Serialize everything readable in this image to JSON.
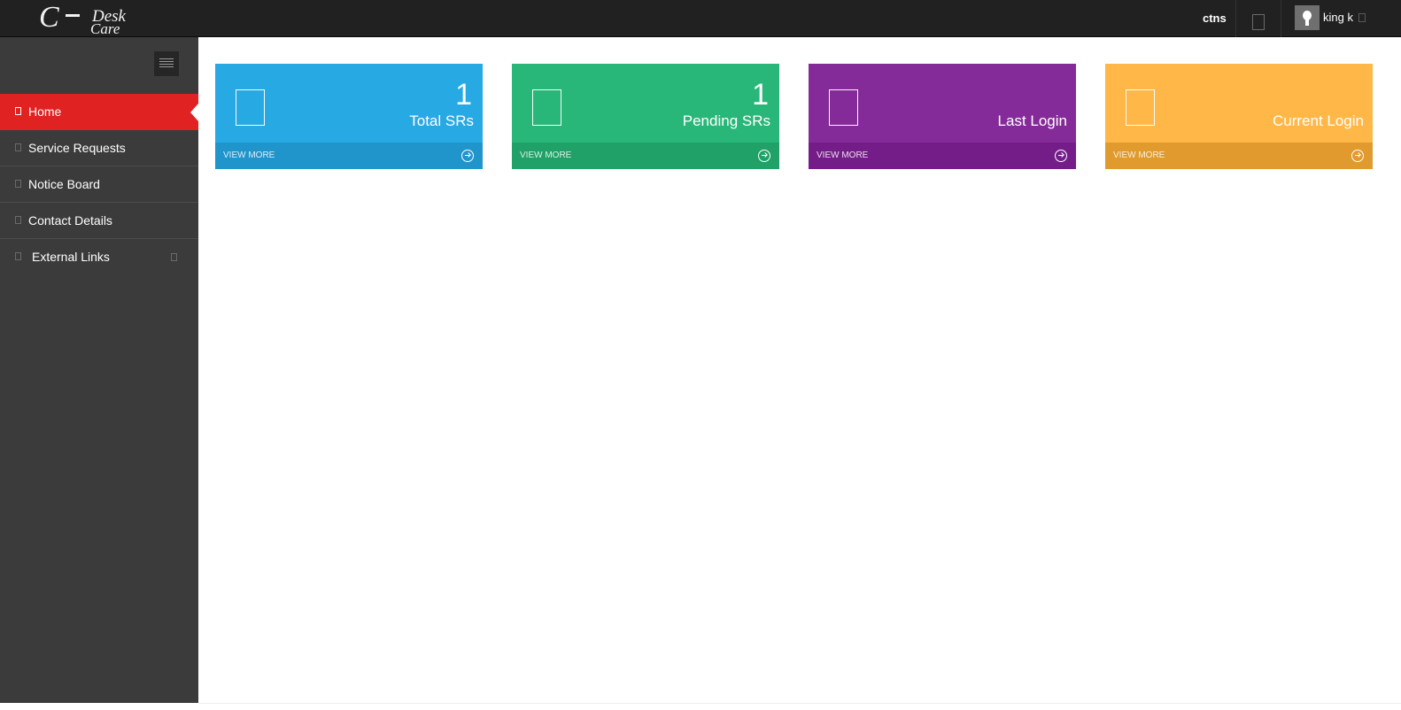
{
  "logo": {
    "letter": "C",
    "word_top": "Desk",
    "word_bottom": "Care"
  },
  "header": {
    "org": "ctns",
    "notification_icon": "notification-icon",
    "user_name": "king k",
    "user_caret_icon": "chevron-down-icon"
  },
  "sidebar": {
    "toggle_icon": "hamburger-icon",
    "items": [
      {
        "label": "Home",
        "icon": "home-icon",
        "active": true
      },
      {
        "label": "Service Requests",
        "icon": "list-icon"
      },
      {
        "label": "Notice Board",
        "icon": "clipboard-icon"
      },
      {
        "label": "Contact Details",
        "icon": "phone-icon"
      },
      {
        "label": "External Links",
        "icon": "link-icon",
        "has_submenu": true
      }
    ]
  },
  "tiles": [
    {
      "number": "1",
      "label": "Total SRs",
      "more": "VIEW MORE",
      "color": "#27a9e3",
      "footer_color": "#2095cc"
    },
    {
      "number": "1",
      "label": "Pending SRs",
      "more": "VIEW MORE",
      "color": "#28b779",
      "footer_color": "#1fa167"
    },
    {
      "number": "",
      "label": "Last Login",
      "more": "VIEW MORE",
      "color": "#852b99",
      "footer_color": "#741d88"
    },
    {
      "number": "",
      "label": "Current Login",
      "more": "VIEW MORE",
      "color": "#ffb848",
      "footer_color": "#e09a2d"
    }
  ]
}
